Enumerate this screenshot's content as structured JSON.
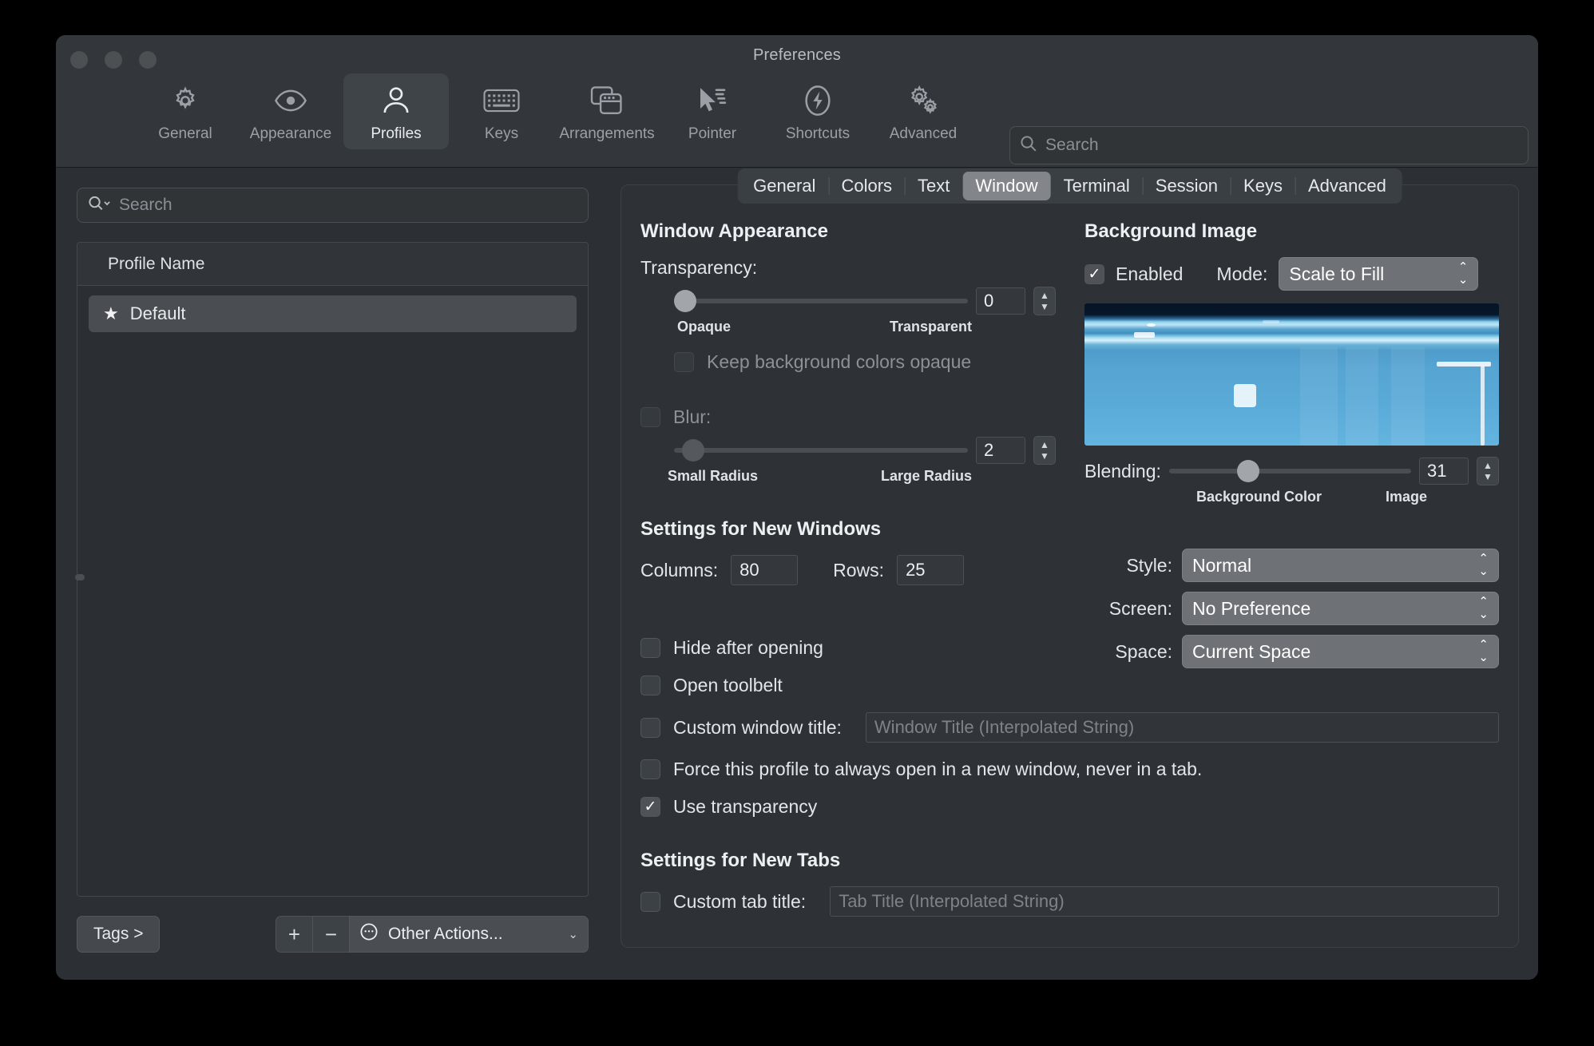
{
  "window": {
    "title": "Preferences",
    "traffic_lights": [
      "close",
      "minimize",
      "zoom"
    ]
  },
  "toolbar": {
    "items": [
      {
        "label": "General",
        "icon": "gear-icon",
        "active": false
      },
      {
        "label": "Appearance",
        "icon": "eye-icon",
        "active": false
      },
      {
        "label": "Profiles",
        "icon": "person-icon",
        "active": true
      },
      {
        "label": "Keys",
        "icon": "keyboard-icon",
        "active": false
      },
      {
        "label": "Arrangements",
        "icon": "windows-icon",
        "active": false
      },
      {
        "label": "Pointer",
        "icon": "cursor-icon",
        "active": false
      },
      {
        "label": "Shortcuts",
        "icon": "bolt-icon",
        "active": false
      },
      {
        "label": "Advanced",
        "icon": "gears-icon",
        "active": false
      }
    ],
    "search": {
      "placeholder": "Search",
      "value": "",
      "caption": "Search",
      "icon": "search-icon"
    }
  },
  "sidebar": {
    "search": {
      "placeholder": "Search",
      "value": "",
      "icon": "search-dropdown-icon"
    },
    "table": {
      "column_header": "Profile Name",
      "rows": [
        {
          "name": "Default",
          "favorite": true,
          "selected": true
        }
      ]
    },
    "bottom": {
      "tags_label": "Tags >",
      "add_label": "+",
      "remove_label": "−",
      "other_actions_label": "Other Actions...",
      "other_actions_icon": "ellipsis-circle-icon",
      "chevron": "⌄"
    }
  },
  "profile_tabs": [
    {
      "label": "General",
      "active": false
    },
    {
      "label": "Colors",
      "active": false
    },
    {
      "label": "Text",
      "active": false
    },
    {
      "label": "Window",
      "active": true
    },
    {
      "label": "Terminal",
      "active": false
    },
    {
      "label": "Session",
      "active": false
    },
    {
      "label": "Keys",
      "active": false
    },
    {
      "label": "Advanced",
      "active": false
    }
  ],
  "window_appearance": {
    "heading": "Window Appearance",
    "transparency": {
      "label": "Transparency:",
      "value": "0",
      "percent": 0,
      "min_label": "Opaque",
      "max_label": "Transparent"
    },
    "keep_background_colors_opaque": {
      "label": "Keep background colors opaque",
      "checked": false,
      "enabled": false
    },
    "blur": {
      "label": "Blur:",
      "checked": false,
      "value": "2",
      "percent": 3,
      "min_label": "Small Radius",
      "max_label": "Large Radius"
    }
  },
  "background_image": {
    "heading": "Background Image",
    "enabled": {
      "label": "Enabled",
      "checked": true
    },
    "mode": {
      "label": "Mode:",
      "value": "Scale to Fill"
    },
    "blending": {
      "label": "Blending:",
      "value": "31",
      "percent": 31,
      "min_label": "Background Color",
      "max_label": "Image"
    }
  },
  "settings_new_windows": {
    "heading": "Settings for New Windows",
    "columns": {
      "label": "Columns:",
      "value": "80"
    },
    "rows": {
      "label": "Rows:",
      "value": "25"
    },
    "checkboxes": [
      {
        "label": "Hide after opening",
        "checked": false
      },
      {
        "label": "Open toolbelt",
        "checked": false
      },
      {
        "label": "Custom window title:",
        "checked": false,
        "field_placeholder": "Window Title (Interpolated String)"
      },
      {
        "label": "Force this profile to always open in a new window, never in a tab.",
        "checked": false
      },
      {
        "label": "Use transparency",
        "checked": true
      }
    ],
    "style": {
      "label": "Style:",
      "value": "Normal"
    },
    "screen": {
      "label": "Screen:",
      "value": "No Preference"
    },
    "space": {
      "label": "Space:",
      "value": "Current Space"
    }
  },
  "settings_new_tabs": {
    "heading": "Settings for New Tabs",
    "custom_tab_title": {
      "label": "Custom tab title:",
      "checked": false,
      "field_placeholder": "Tab Title (Interpolated String)"
    }
  },
  "colors": {
    "window_bg": "#2c3034",
    "titlebar_bg": "#33373b",
    "panel_bg": "#2e3236",
    "accent_selected": "#4a4e52",
    "popup_bg": "#6e7276",
    "text_primary": "#e8ebee",
    "text_dim": "#8b9197"
  }
}
